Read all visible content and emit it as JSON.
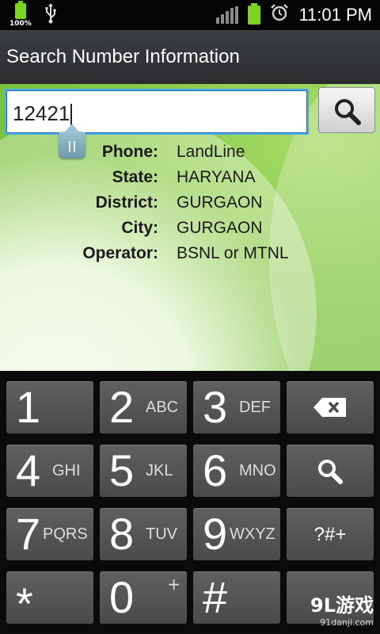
{
  "status_bar": {
    "battery_percent": "100%",
    "time": "11:01 PM",
    "icons": [
      "battery-icon",
      "usb-icon",
      "signal-icon",
      "battery-icon",
      "alarm-icon"
    ]
  },
  "title_bar": {
    "title": "Search Number Information"
  },
  "search": {
    "value": "12421",
    "button_icon": "search-icon"
  },
  "info": [
    {
      "label": "Phone:",
      "value": "LandLine"
    },
    {
      "label": "State:",
      "value": "HARYANA"
    },
    {
      "label": "District:",
      "value": "GURGAON"
    },
    {
      "label": "City:",
      "value": "GURGAON"
    },
    {
      "label": "Operator:",
      "value": "BSNL or MTNL"
    }
  ],
  "keypad": {
    "keys": [
      {
        "num": "1",
        "letters": ""
      },
      {
        "num": "2",
        "letters": "ABC"
      },
      {
        "num": "3",
        "letters": "DEF"
      },
      {
        "num": "4",
        "letters": "GHI"
      },
      {
        "num": "5",
        "letters": "JKL"
      },
      {
        "num": "6",
        "letters": "MNO"
      },
      {
        "num": "7",
        "letters": "PQRS"
      },
      {
        "num": "8",
        "letters": "TUV"
      },
      {
        "num": "9",
        "letters": "WXYZ"
      },
      {
        "num": "*",
        "letters": ""
      },
      {
        "num": "0",
        "letters": "+"
      },
      {
        "num": "#",
        "letters": ""
      }
    ],
    "symbols_label": "?#+",
    "side_icons": [
      "backspace-icon",
      "search-icon"
    ]
  },
  "watermark": {
    "brand": "9L游戏",
    "url": "91danji.com"
  }
}
